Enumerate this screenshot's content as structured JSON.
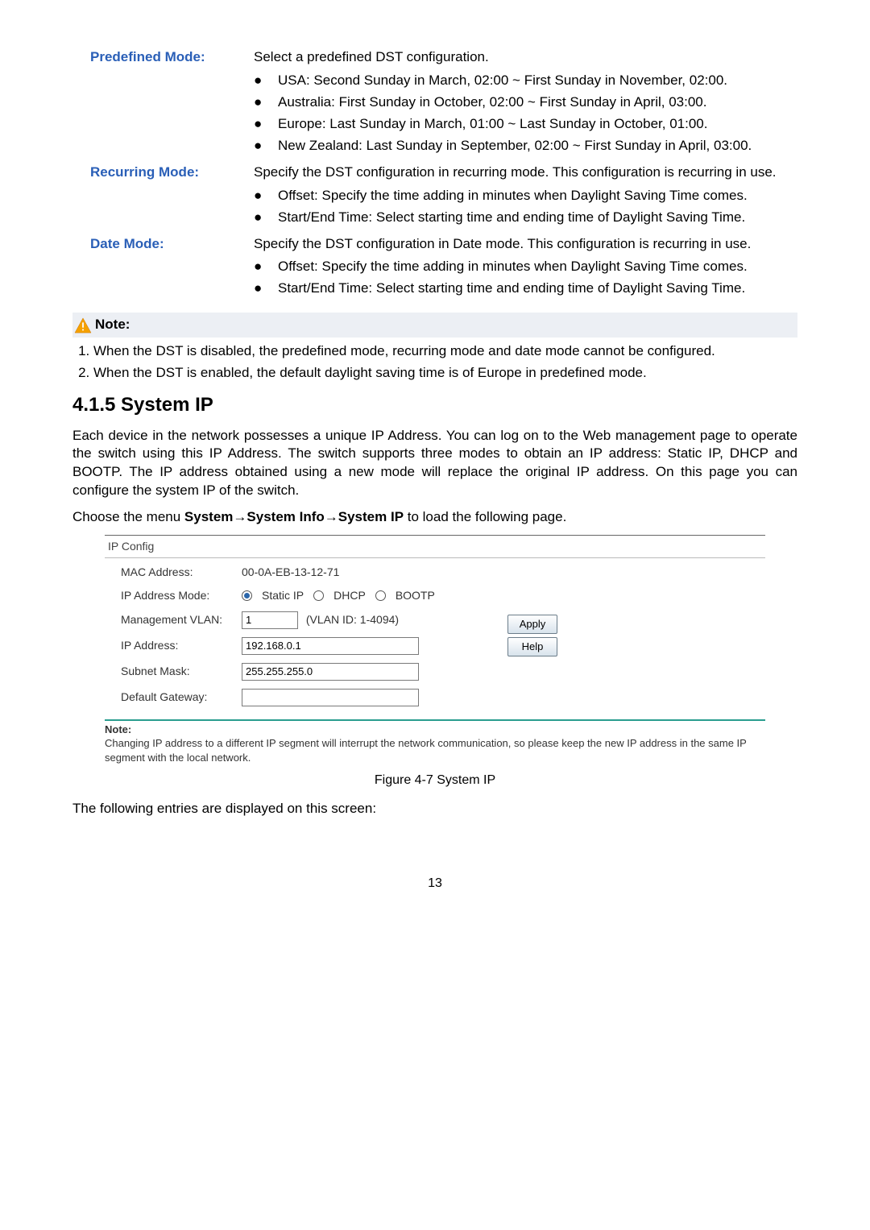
{
  "defs": {
    "predefined": {
      "title": "Predefined Mode:",
      "intro": "Select a predefined DST configuration.",
      "items": [
        "USA: Second Sunday in March, 02:00 ~ First Sunday in November, 02:00.",
        "Australia: First Sunday in October, 02:00 ~ First Sunday in April, 03:00.",
        "Europe: Last Sunday in March, 01:00 ~ Last Sunday in October, 01:00.",
        "New Zealand: Last Sunday in September, 02:00 ~ First Sunday in April, 03:00."
      ]
    },
    "recurring": {
      "title": "Recurring Mode:",
      "intro": "Specify the DST configuration in recurring mode. This configuration is recurring in use.",
      "items": [
        "Offset: Specify the time adding in minutes when Daylight Saving Time comes.",
        "Start/End Time: Select starting time and ending time of Daylight Saving Time."
      ]
    },
    "datemode": {
      "title": "Date Mode:",
      "intro": "Specify the DST configuration in Date mode. This configuration is recurring in use.",
      "items": [
        "Offset: Specify the time adding in minutes when Daylight Saving Time comes.",
        "Start/End Time: Select starting time and ending time of Daylight Saving Time."
      ]
    }
  },
  "noteTitle": "Note:",
  "notes": [
    "When the DST is disabled, the predefined mode, recurring mode and date mode cannot be configured.",
    "When the DST is enabled, the default daylight saving time is of Europe in predefined mode."
  ],
  "section": {
    "heading": "4.1.5 System IP",
    "para1": "Each device in the network possesses a unique IP Address. You can log on to the Web management page to operate the switch using this IP Address. The switch supports three modes to obtain an IP address: Static IP, DHCP and BOOTP. The IP address obtained using a new mode will replace the original IP address. On this page you can configure the system IP of the switch.",
    "menuPath": {
      "lead": "Choose the menu ",
      "seg1": "System",
      "sep": "→",
      "seg2": "System Info",
      "seg3": "System IP",
      "tail": " to load the following page."
    }
  },
  "panel": {
    "title": "IP Config",
    "rows": {
      "mac": {
        "label": "MAC Address:",
        "value": "00-0A-EB-13-12-71"
      },
      "mode": {
        "label": "IP Address Mode:",
        "opts": [
          "Static IP",
          "DHCP",
          "BOOTP"
        ],
        "selected": 0
      },
      "vlan": {
        "label": "Management VLAN:",
        "value": "1",
        "hint": "(VLAN ID: 1-4094)"
      },
      "ip": {
        "label": "IP Address:",
        "value": "192.168.0.1"
      },
      "mask": {
        "label": "Subnet Mask:",
        "value": "255.255.255.0"
      },
      "gw": {
        "label": "Default Gateway:",
        "value": ""
      }
    },
    "buttons": {
      "apply": "Apply",
      "help": "Help"
    },
    "note": {
      "hd": "Note:",
      "body": "Changing IP address to a different IP segment will interrupt the network communication, so please keep the new IP address in the same IP segment with the local network."
    }
  },
  "figcaption": "Figure 4-7 System IP",
  "entriesLine": "The following entries are displayed on this screen:",
  "pageNumber": "13"
}
